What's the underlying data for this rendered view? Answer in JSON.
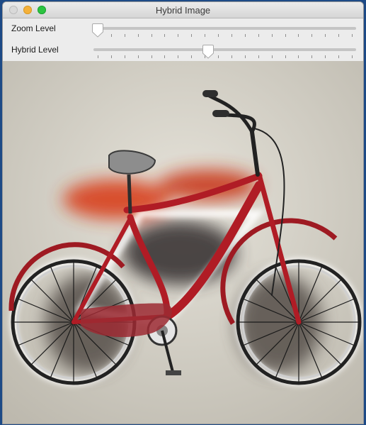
{
  "window": {
    "title": "Hybrid Image"
  },
  "controls": {
    "zoom": {
      "label": "Zoom Level",
      "value_fraction": 0.0,
      "tick_count": 20
    },
    "hybrid": {
      "label": "Hybrid Level",
      "value_fraction": 0.435,
      "tick_count": 20
    }
  },
  "image": {
    "subject": "bicycle-hybrid-image"
  },
  "colors": {
    "bike_frame": "#b01c25",
    "motorcycle": "#d8401c",
    "backdrop": "#d4d1c8"
  }
}
